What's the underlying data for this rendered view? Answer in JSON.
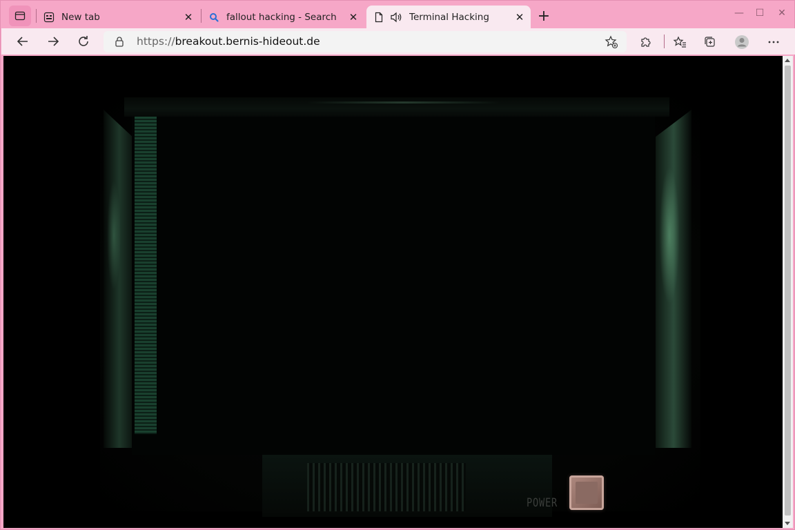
{
  "browser": {
    "tabs": [
      {
        "label": "New tab",
        "icon": "new-tab-page-icon",
        "active": false
      },
      {
        "label": "fallout hacking - Search",
        "icon": "search-icon",
        "active": false
      },
      {
        "label": "Terminal Hacking",
        "icon": "page-icon",
        "active": true,
        "audio_icon": "speaker-icon"
      }
    ],
    "url_scheme": "https://",
    "url_host": "breakout.bernis-hideout.de",
    "colors": {
      "frame": "#f6a7c7",
      "toolbar": "#f9e9f0",
      "active_tab": "#f9e9f0",
      "content_bg": "#000000"
    }
  },
  "page": {
    "power_label": "POWER",
    "accent": "#2e5a44"
  }
}
